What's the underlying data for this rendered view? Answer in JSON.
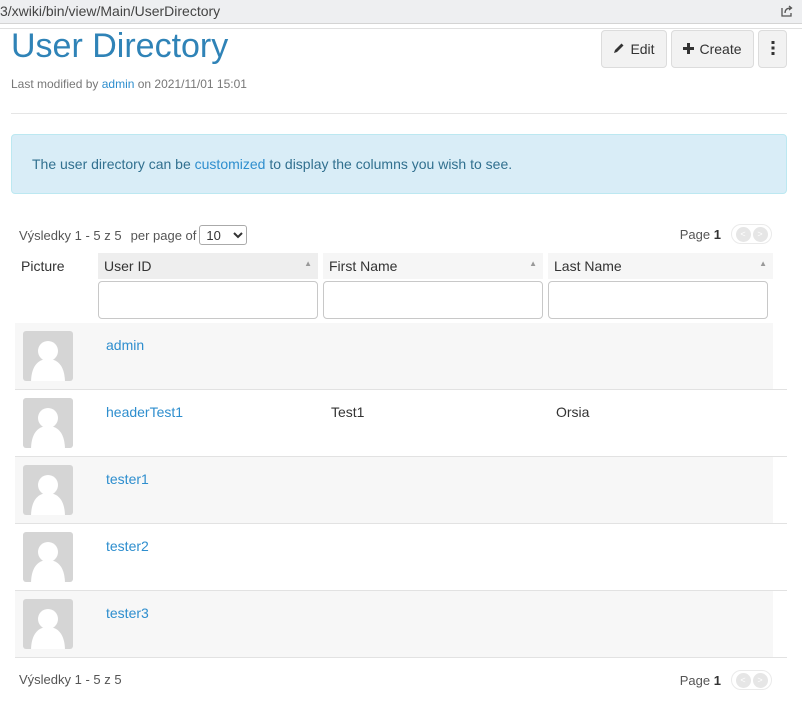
{
  "browser": {
    "url": "3/xwiki/bin/view/Main/UserDirectory",
    "share_icon": "share-icon"
  },
  "page": {
    "title": "User Directory",
    "meta_prefix": "Last modified by ",
    "meta_author": "admin",
    "meta_suffix": " on 2021/11/01 15:01"
  },
  "toolbar": {
    "edit_label": "Edit",
    "edit_icon": "pencil-icon",
    "create_label": "Create",
    "create_icon": "plus-icon",
    "more_icon": "vertical-ellipsis-icon"
  },
  "alert": {
    "before": "The user directory can be ",
    "link": "customized",
    "after": " to display the columns you wish to see."
  },
  "livetable": {
    "results_label": "Výsledky 1 - 5 z 5",
    "per_page_label": "per page of",
    "per_page_value": "10",
    "page_label": "Page",
    "page_number": "1",
    "prev_glyph": "<",
    "next_glyph": ">",
    "sort_glyph": "▲",
    "columns": [
      {
        "label": "Picture"
      },
      {
        "label": "User ID"
      },
      {
        "label": "First Name"
      },
      {
        "label": "Last Name"
      }
    ],
    "filters": {
      "user_id": "",
      "first_name": "",
      "last_name": ""
    },
    "rows": [
      {
        "user_id": "admin",
        "first_name": "",
        "last_name": ""
      },
      {
        "user_id": "headerTest1",
        "first_name": "Test1",
        "last_name": "Orsia"
      },
      {
        "user_id": "tester1",
        "first_name": "",
        "last_name": ""
      },
      {
        "user_id": "tester2",
        "first_name": "",
        "last_name": ""
      },
      {
        "user_id": "tester3",
        "first_name": "",
        "last_name": ""
      }
    ],
    "colors": {
      "link": "#2e8ece",
      "title": "#2f83b7",
      "alert_bg": "#d9edf7",
      "alert_text": "#31708f"
    }
  }
}
